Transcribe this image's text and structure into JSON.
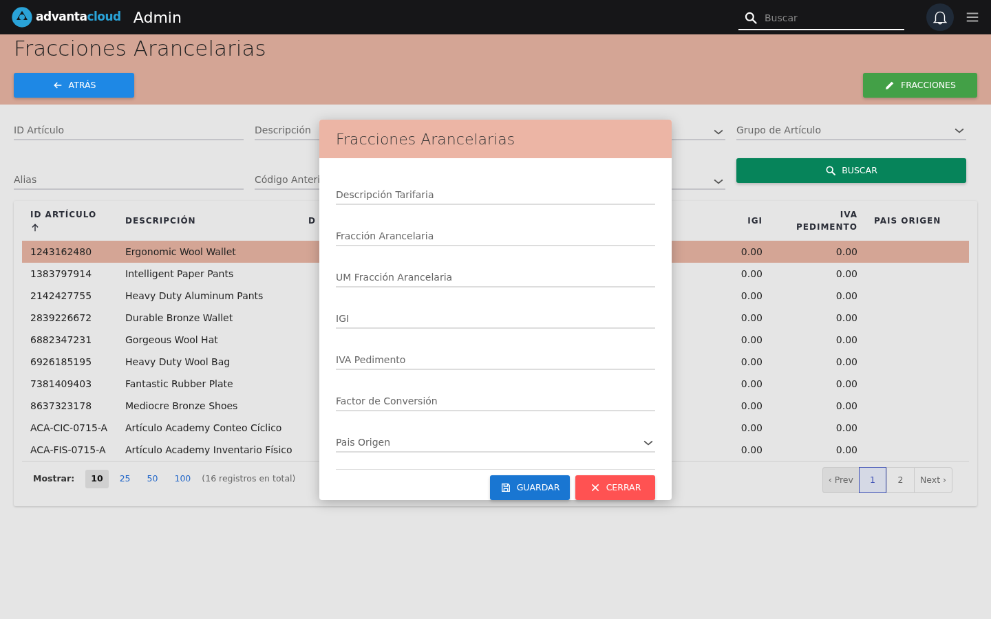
{
  "navbar": {
    "logo_text": {
      "first": "advanta",
      "second": "cloud"
    },
    "app_title": "Admin",
    "search": {
      "placeholder": "Buscar"
    }
  },
  "page": {
    "title": "Fracciones Arancelarias",
    "back_button": "ATRÁS",
    "fracciones_button": "FRACCIONES"
  },
  "filters": [
    {
      "kind": "text",
      "label": "ID Artículo"
    },
    {
      "kind": "text",
      "label": "Descripción"
    },
    {
      "kind": "select"
    },
    {
      "kind": "select",
      "label": "Grupo de Artículo"
    },
    {
      "kind": "text",
      "label": "Alias"
    },
    {
      "kind": "text",
      "label": "Código Anteri"
    },
    {
      "kind": "select"
    },
    {
      "kind": "button",
      "label": "BUSCAR"
    }
  ],
  "table": {
    "columns": [
      {
        "label": "ID ARTÍCULO",
        "sorted": true
      },
      {
        "label": "DESCRIPCIÓN"
      },
      {
        "label": "D"
      },
      {
        "label": "IGI"
      },
      {
        "label": "IVA PEDIMENTO"
      },
      {
        "label": "PAIS ORIGEN"
      }
    ],
    "rows": [
      {
        "selected": true,
        "cells": [
          "1243162480",
          "Ergonomic Wool Wallet",
          "",
          "0.00",
          "0.00",
          ""
        ]
      },
      {
        "selected": false,
        "cells": [
          "1383797914",
          "Intelligent Paper Pants",
          "",
          "0.00",
          "0.00",
          ""
        ]
      },
      {
        "selected": false,
        "cells": [
          "2142427755",
          "Heavy Duty Aluminum Pants",
          "",
          "0.00",
          "0.00",
          ""
        ]
      },
      {
        "selected": false,
        "cells": [
          "2839226672",
          "Durable Bronze Wallet",
          "",
          "0.00",
          "0.00",
          ""
        ]
      },
      {
        "selected": false,
        "cells": [
          "6882347231",
          "Gorgeous Wool Hat",
          "",
          "0.00",
          "0.00",
          ""
        ]
      },
      {
        "selected": false,
        "cells": [
          "6926185195",
          "Heavy Duty Wool Bag",
          "",
          "0.00",
          "0.00",
          ""
        ]
      },
      {
        "selected": false,
        "cells": [
          "7381409403",
          "Fantastic Rubber Plate",
          "",
          "0.00",
          "0.00",
          ""
        ]
      },
      {
        "selected": false,
        "cells": [
          "8637323178",
          "Mediocre Bronze Shoes",
          "",
          "0.00",
          "0.00",
          ""
        ]
      },
      {
        "selected": false,
        "cells": [
          "ACA-CIC-0715-A",
          "Artículo Academy Conteo Cíclico",
          "",
          "0.00",
          "0.00",
          ""
        ]
      },
      {
        "selected": false,
        "cells": [
          "ACA-FIS-0715-A",
          "Artículo Academy Inventario Físico",
          "",
          "0.00",
          "0.00",
          ""
        ]
      }
    ]
  },
  "footer": {
    "show_label": "Mostrar:",
    "page_sizes": [
      {
        "label": "10",
        "selected": true
      },
      {
        "label": "25",
        "selected": false
      },
      {
        "label": "50",
        "selected": false
      },
      {
        "label": "100",
        "selected": false
      }
    ],
    "total": "(16 registros en total)",
    "pagination": [
      {
        "label": "‹ Prev",
        "selected": false,
        "disabled": true
      },
      {
        "label": "1",
        "selected": true,
        "disabled": false
      },
      {
        "label": "2",
        "selected": false,
        "disabled": false
      },
      {
        "label": "Next ›",
        "selected": false,
        "disabled": false
      }
    ]
  },
  "modal": {
    "title": "Fracciones Arancelarias",
    "fields": [
      {
        "kind": "text",
        "label": "Descripción Tarifaria"
      },
      {
        "kind": "text",
        "label": "Fracción Arancelaria"
      },
      {
        "kind": "text",
        "label": "UM Fracción Arancelaria"
      },
      {
        "kind": "text",
        "label": "IGI"
      },
      {
        "kind": "text",
        "label": "IVA Pedimento"
      },
      {
        "kind": "text",
        "label": "Factor de Conversión"
      },
      {
        "kind": "select",
        "label": "Pais Origen"
      }
    ],
    "save_button": "GUARDAR",
    "close_button": "CERRAR"
  }
}
